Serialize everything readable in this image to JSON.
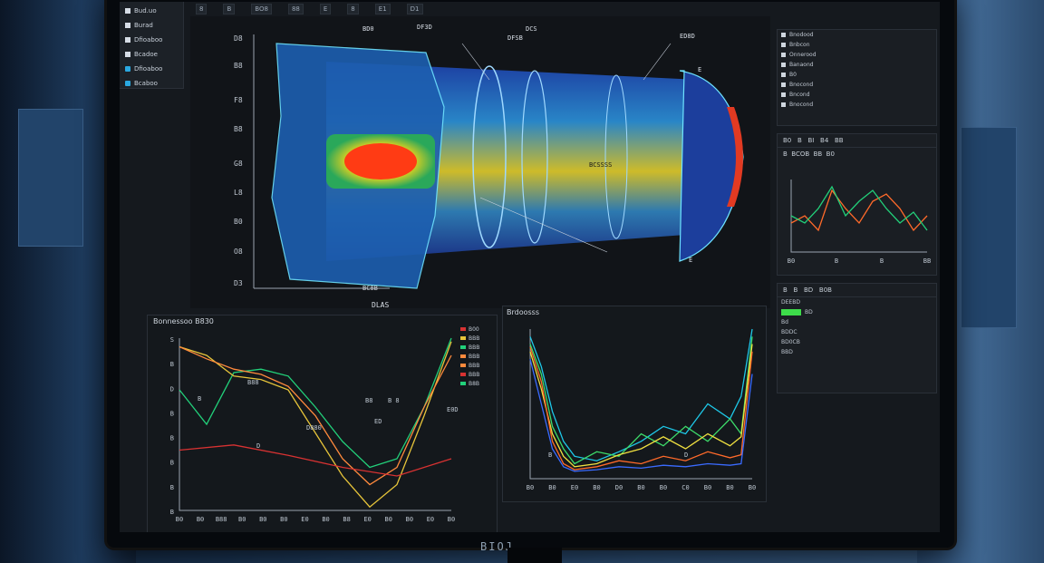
{
  "app": {
    "brand": "BIOJ"
  },
  "file_tree": [
    {
      "label": "Bud.uo",
      "icon": "file-icon"
    },
    {
      "label": "Burad",
      "icon": "file-icon"
    },
    {
      "label": "Dfioaboo",
      "icon": "file-icon"
    },
    {
      "label": "Bcadoe",
      "icon": "file-icon"
    },
    {
      "label": "Dfioaboo",
      "icon": "cube-icon"
    },
    {
      "label": "Bcaboo",
      "icon": "cube-icon"
    }
  ],
  "view3d": {
    "y_ticks": [
      "D8",
      "B8",
      "F8",
      "B8",
      "G8",
      "L8",
      "B0",
      "O8",
      "D3"
    ],
    "annotations": [
      "DF3D",
      "DFSB",
      "ED8D",
      "E",
      "BC8B",
      "BCSSSS",
      "E",
      "DCS",
      "BD0"
    ],
    "bottom_label": "DLAS"
  },
  "toolbar": [
    "8",
    "B",
    "BO8",
    "88",
    "E",
    "8",
    "E1",
    "D1"
  ],
  "right_tree": {
    "rows": [
      "Bnodood",
      "Bnbcon",
      "Onnerood",
      "Banaond",
      "B0",
      "Bnocond",
      "Bncond",
      "Bnocond"
    ]
  },
  "right_chart": {
    "header": [
      "B0",
      "B",
      "BI",
      "B4",
      "BB"
    ],
    "sub": [
      "B",
      "BCOB",
      "BB",
      "B0"
    ]
  },
  "right_props": {
    "header": [
      "B",
      "B",
      "BD",
      "B0B"
    ],
    "rows": [
      "DEEBD",
      "BD",
      "Bd",
      "BDDC",
      "BD0CB",
      "BBD"
    ]
  },
  "chart_left": {
    "title": "Bonnessoo B830",
    "legend": [
      "B00",
      "BBB",
      "BBB",
      "BBB",
      "BBB",
      "BBB",
      "B8B"
    ],
    "annotations": [
      "B",
      "B88",
      "D880",
      "B8",
      "B 8",
      "D",
      "ED",
      "E0D"
    ]
  },
  "chart_mid": {
    "title": "Brdoosss",
    "annotations": [
      "B",
      "D"
    ]
  },
  "chart_data": [
    {
      "type": "line",
      "title": "Bonnessoo B830",
      "x_tick_labels": [
        "B0",
        "B0",
        "B88",
        "B0",
        "B0",
        "B0",
        "E0",
        "B0",
        "B8",
        "E0",
        "B0",
        "B0",
        "E0",
        "B0"
      ],
      "y_tick_labels": [
        "S",
        "B",
        "D",
        "B",
        "B",
        "B",
        "B",
        "B"
      ],
      "xlim": [
        0,
        100
      ],
      "ylim": [
        0,
        100
      ],
      "series": [
        {
          "color": "#22d07a",
          "x": [
            0,
            10,
            20,
            30,
            40,
            50,
            60,
            70,
            80,
            90,
            100
          ],
          "y": [
            70,
            50,
            80,
            82,
            78,
            60,
            40,
            25,
            30,
            60,
            100
          ]
        },
        {
          "color": "#e6c43a",
          "x": [
            0,
            10,
            20,
            30,
            40,
            50,
            60,
            70,
            80,
            90,
            100
          ],
          "y": [
            95,
            90,
            78,
            76,
            70,
            45,
            20,
            2,
            15,
            55,
            98
          ]
        },
        {
          "color": "#ff8a3d",
          "x": [
            0,
            10,
            20,
            30,
            40,
            50,
            60,
            70,
            80,
            90,
            100
          ],
          "y": [
            95,
            88,
            82,
            79,
            72,
            55,
            30,
            15,
            25,
            60,
            90
          ]
        },
        {
          "color": "#d83232",
          "x": [
            0,
            20,
            40,
            60,
            80,
            100
          ],
          "y": [
            35,
            38,
            32,
            25,
            20,
            30
          ]
        }
      ]
    },
    {
      "type": "line",
      "title": "Brdoosss",
      "x_tick_labels": [
        "B0",
        "B0",
        "E0",
        "B0",
        "D0",
        "B0",
        "B0",
        "C0",
        "B0",
        "B0",
        "B0"
      ],
      "xlim": [
        0,
        100
      ],
      "ylim": [
        0,
        100
      ],
      "series": [
        {
          "color": "#1ec8e8",
          "x": [
            0,
            5,
            10,
            15,
            20,
            30,
            40,
            50,
            60,
            70,
            80,
            90,
            95,
            100
          ],
          "y": [
            95,
            75,
            45,
            25,
            15,
            12,
            18,
            25,
            35,
            30,
            50,
            40,
            55,
            100
          ]
        },
        {
          "color": "#3ddc6a",
          "x": [
            0,
            5,
            10,
            15,
            20,
            30,
            40,
            50,
            60,
            70,
            80,
            90,
            95,
            100
          ],
          "y": [
            90,
            70,
            35,
            20,
            10,
            18,
            15,
            30,
            22,
            35,
            25,
            40,
            30,
            95
          ]
        },
        {
          "color": "#f0e040",
          "x": [
            0,
            5,
            10,
            15,
            20,
            30,
            40,
            50,
            60,
            70,
            80,
            90,
            95,
            100
          ],
          "y": [
            85,
            60,
            30,
            15,
            8,
            10,
            16,
            20,
            28,
            20,
            30,
            22,
            28,
            90
          ]
        },
        {
          "color": "#ff6a2a",
          "x": [
            0,
            5,
            10,
            15,
            20,
            30,
            40,
            50,
            60,
            70,
            80,
            90,
            95,
            100
          ],
          "y": [
            88,
            65,
            25,
            10,
            6,
            8,
            12,
            10,
            15,
            12,
            18,
            14,
            16,
            85
          ]
        },
        {
          "color": "#3a6bff",
          "x": [
            0,
            5,
            10,
            15,
            20,
            30,
            40,
            50,
            60,
            70,
            80,
            90,
            95,
            100
          ],
          "y": [
            80,
            50,
            20,
            8,
            5,
            6,
            8,
            7,
            9,
            8,
            10,
            9,
            10,
            70
          ]
        }
      ]
    },
    {
      "type": "line",
      "title": "",
      "x_tick_labels": [
        "B0",
        "B",
        "B",
        "BB"
      ],
      "xlim": [
        0,
        100
      ],
      "ylim": [
        0,
        100
      ],
      "series": [
        {
          "color": "#ff6a2a",
          "x": [
            0,
            10,
            20,
            30,
            40,
            50,
            60,
            70,
            80,
            90,
            100
          ],
          "y": [
            40,
            50,
            30,
            85,
            60,
            40,
            70,
            80,
            60,
            30,
            50
          ]
        },
        {
          "color": "#22d07a",
          "x": [
            0,
            10,
            20,
            30,
            40,
            50,
            60,
            70,
            80,
            90,
            100
          ],
          "y": [
            50,
            40,
            60,
            90,
            50,
            70,
            85,
            60,
            40,
            55,
            30
          ]
        }
      ]
    }
  ]
}
